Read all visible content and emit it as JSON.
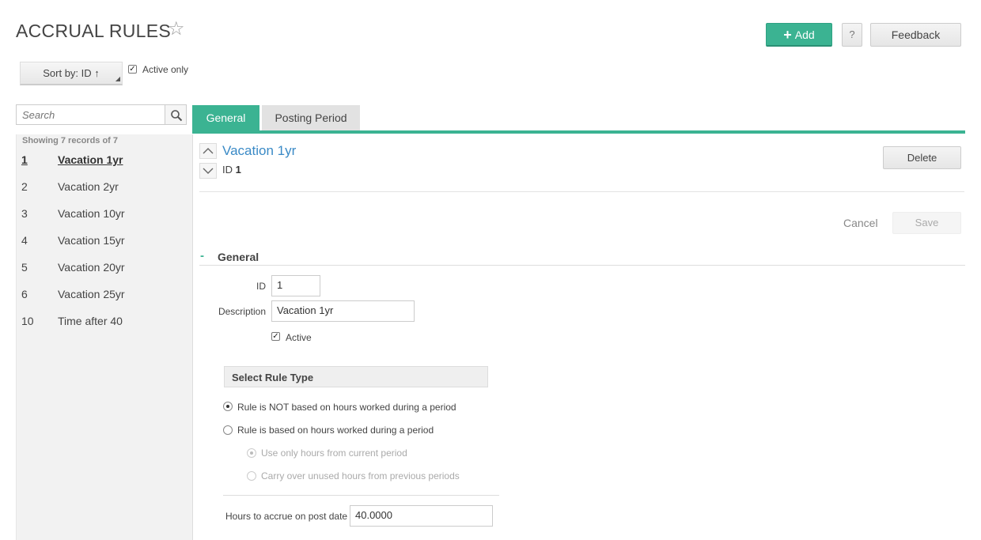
{
  "header": {
    "title": "ACCRUAL RULES",
    "favorite_icon": "star-outline-icon",
    "add_label": "Add",
    "help_label": "?",
    "feedback_label": "Feedback"
  },
  "toolbar": {
    "sort_label": "Sort by: ID ↑",
    "active_only_label": "Active only",
    "active_only_checked": true
  },
  "search": {
    "placeholder": "Search"
  },
  "records": {
    "showing_text": "Showing 7 records of 7",
    "items": [
      {
        "id": "1",
        "description": "Vacation 1yr",
        "selected": true
      },
      {
        "id": "2",
        "description": "Vacation 2yr"
      },
      {
        "id": "3",
        "description": "Vacation 10yr"
      },
      {
        "id": "4",
        "description": "Vacation 15yr"
      },
      {
        "id": "5",
        "description": "Vacation 20yr"
      },
      {
        "id": "6",
        "description": "Vacation 25yr"
      },
      {
        "id": "10",
        "description": "Time after 40"
      }
    ]
  },
  "tabs": [
    {
      "label": "General",
      "active": true
    },
    {
      "label": "Posting Period",
      "active": false
    }
  ],
  "detail": {
    "title": "Vacation 1yr",
    "id_prefix": "ID",
    "id_value": "1",
    "delete_label": "Delete",
    "cancel_label": "Cancel",
    "save_label": "Save"
  },
  "general_section": {
    "toggle_symbol": "-",
    "title": "General",
    "id_label": "ID",
    "id_value": "1",
    "description_label": "Description",
    "description_value": "Vacation 1yr",
    "active_label": "Active",
    "active_checked": true
  },
  "rule_type": {
    "heading": "Select Rule Type",
    "options": [
      {
        "label": "Rule is NOT based on hours worked during a period",
        "selected": true,
        "disabled": false
      },
      {
        "label": "Rule is based on hours worked during a period",
        "selected": false,
        "disabled": false
      },
      {
        "label": "Use only hours from current period",
        "selected": true,
        "disabled": true
      },
      {
        "label": "Carry over unused hours from previous periods",
        "selected": false,
        "disabled": true
      }
    ],
    "hours_label": "Hours to accrue on post date",
    "hours_value": "40.0000"
  },
  "colors": {
    "accent": "#3bb392",
    "link": "#3a8ac6"
  }
}
